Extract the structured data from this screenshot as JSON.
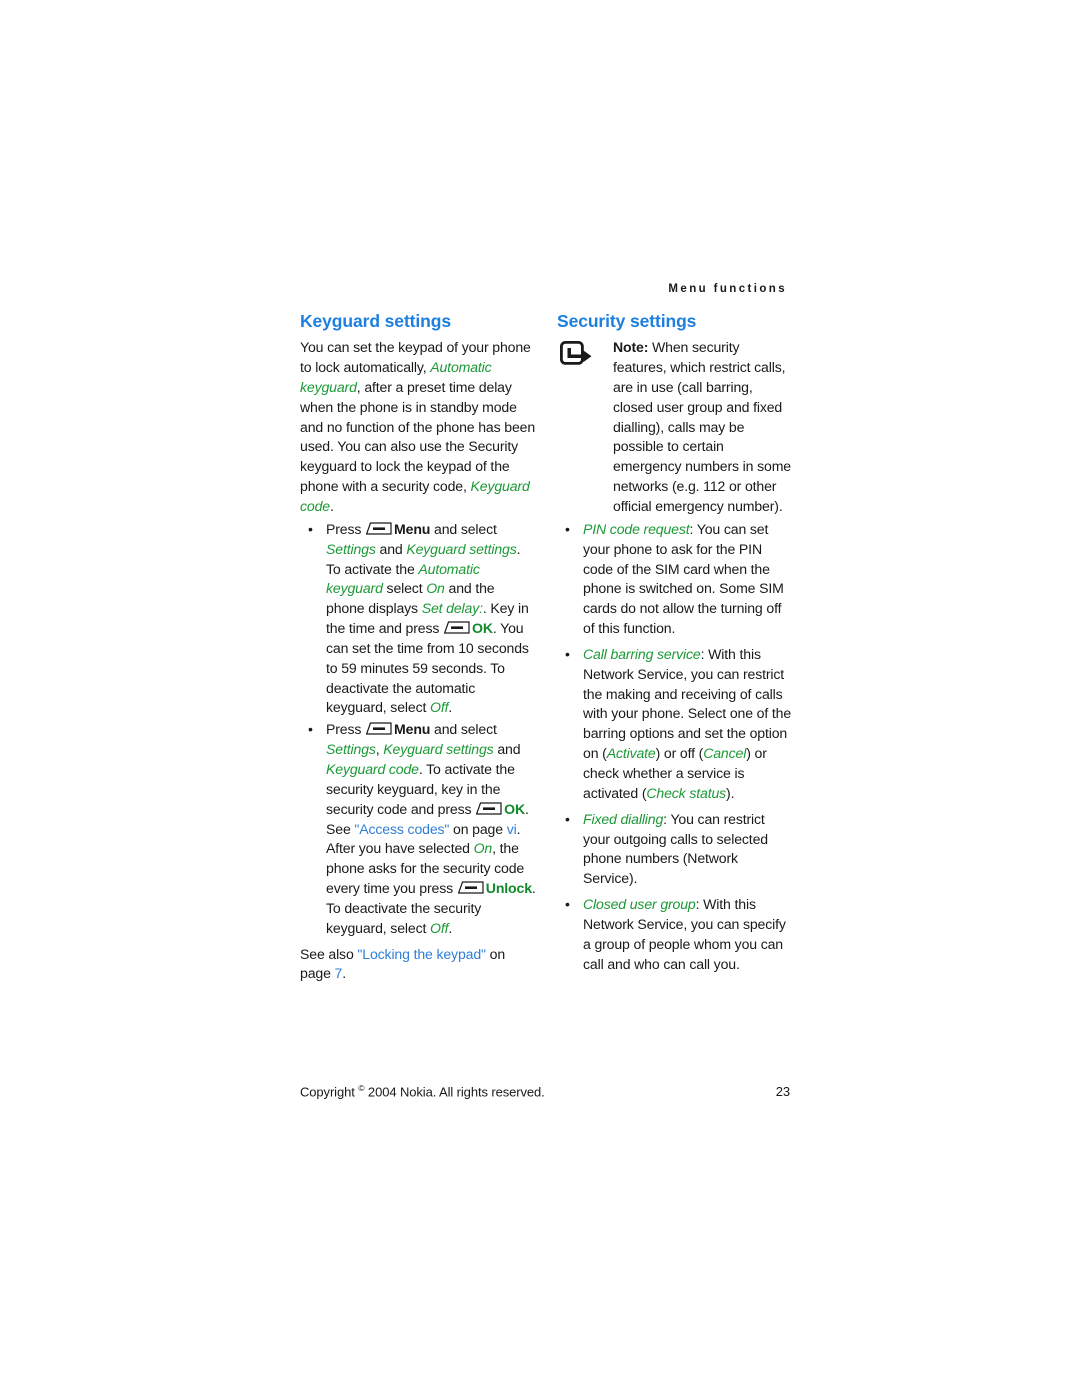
{
  "header": {
    "running_head": "Menu functions"
  },
  "left_column": {
    "title": "Keyguard settings",
    "intro": {
      "part1": "You can set the keypad of your phone to lock automatically, ",
      "em1": "Automatic keyguard",
      "part2": ", after a preset time delay when the phone is in standby mode and no function of the phone has been used. You can also use the Security keyguard to lock the keypad of the phone with a security code, ",
      "em2": "Keyguard code",
      "part3": "."
    },
    "bullets": [
      {
        "t1": "Press ",
        "icon": "softkey-icon",
        "t2": "Menu",
        "t3": " and select ",
        "em1": "Settings",
        "t4": " and ",
        "em2": "Keyguard settings",
        "t5": ". To activate the ",
        "em3": "Automatic keyguard",
        "t6": " select ",
        "em4": "On",
        "t7": " and the phone displays ",
        "em5": "Set delay:",
        "t8": ". Key in the time and press ",
        "t9": "OK",
        "t10": ". You can set the time from 10 seconds to 59 minutes 59 seconds. To deactivate the automatic keyguard, select ",
        "em6": "Off",
        "t11": "."
      },
      {
        "t1": "Press ",
        "icon": "softkey-icon",
        "t2": "Menu",
        "t3": " and select ",
        "em1": "Settings",
        "t4": ", ",
        "em2": "Keyguard settings",
        "t5": " and ",
        "em3": "Keyguard code",
        "t6": ". To activate the security keyguard, key in the security code and press ",
        "t7": "OK",
        "t8": ". See ",
        "link1": "\"Access codes\"",
        "t9": " on page ",
        "link2": "vi",
        "t10": ". After you have selected ",
        "em4": "On",
        "t11": ", the phone asks for the security code every time you press ",
        "t12": "Unlock",
        "t13": ". To deactivate the security keyguard, select ",
        "em5": "Off",
        "t14": "."
      }
    ],
    "see_also": {
      "t1": "See also ",
      "link1": "\"Locking the keypad\"",
      "t2": " on page ",
      "link2": "7",
      "t3": "."
    }
  },
  "right_column": {
    "title": "Security settings",
    "note": {
      "icon": "note-arrow-icon",
      "label": "Note:",
      "text": " When security features, which restrict calls, are in use (call barring, closed user group and fixed dialling), calls may be possible to certain emergency numbers in some networks (e.g. 112 or other official emergency number)."
    },
    "bullets": [
      {
        "em1": "PIN code request",
        "t1": ": You can set your phone to ask for the PIN code of the SIM card when the phone is switched on. Some SIM cards do not allow the turning off of this function."
      },
      {
        "em1": "Call barring service",
        "t1": ": With this Network Service, you can restrict the making and receiving of calls with your phone. Select one of the barring options and set the option on (",
        "em2": "Activate",
        "t2": ") or off (",
        "em3": "Cancel",
        "t3": ") or check whether a service is activated (",
        "em4": "Check status",
        "t4": ")."
      },
      {
        "em1": "Fixed dialling",
        "t1": ": You can restrict your outgoing calls to selected phone numbers (Network Service)."
      },
      {
        "em1": "Closed user group",
        "t1": ": With this Network Service, you can specify a group of people whom you can call and who can call you."
      }
    ]
  },
  "footer": {
    "copyright_pre": "Copyright ",
    "copyright_symbol": "©",
    "copyright_post": " 2004 Nokia. All rights reserved.",
    "page_number": "23"
  },
  "colors": {
    "heading_blue": "#1d7fe0",
    "emphasis_green": "#1c9936",
    "bold_green": "#12892c",
    "link_blue": "#2f7fd6",
    "body_black": "#1a1a1a"
  }
}
